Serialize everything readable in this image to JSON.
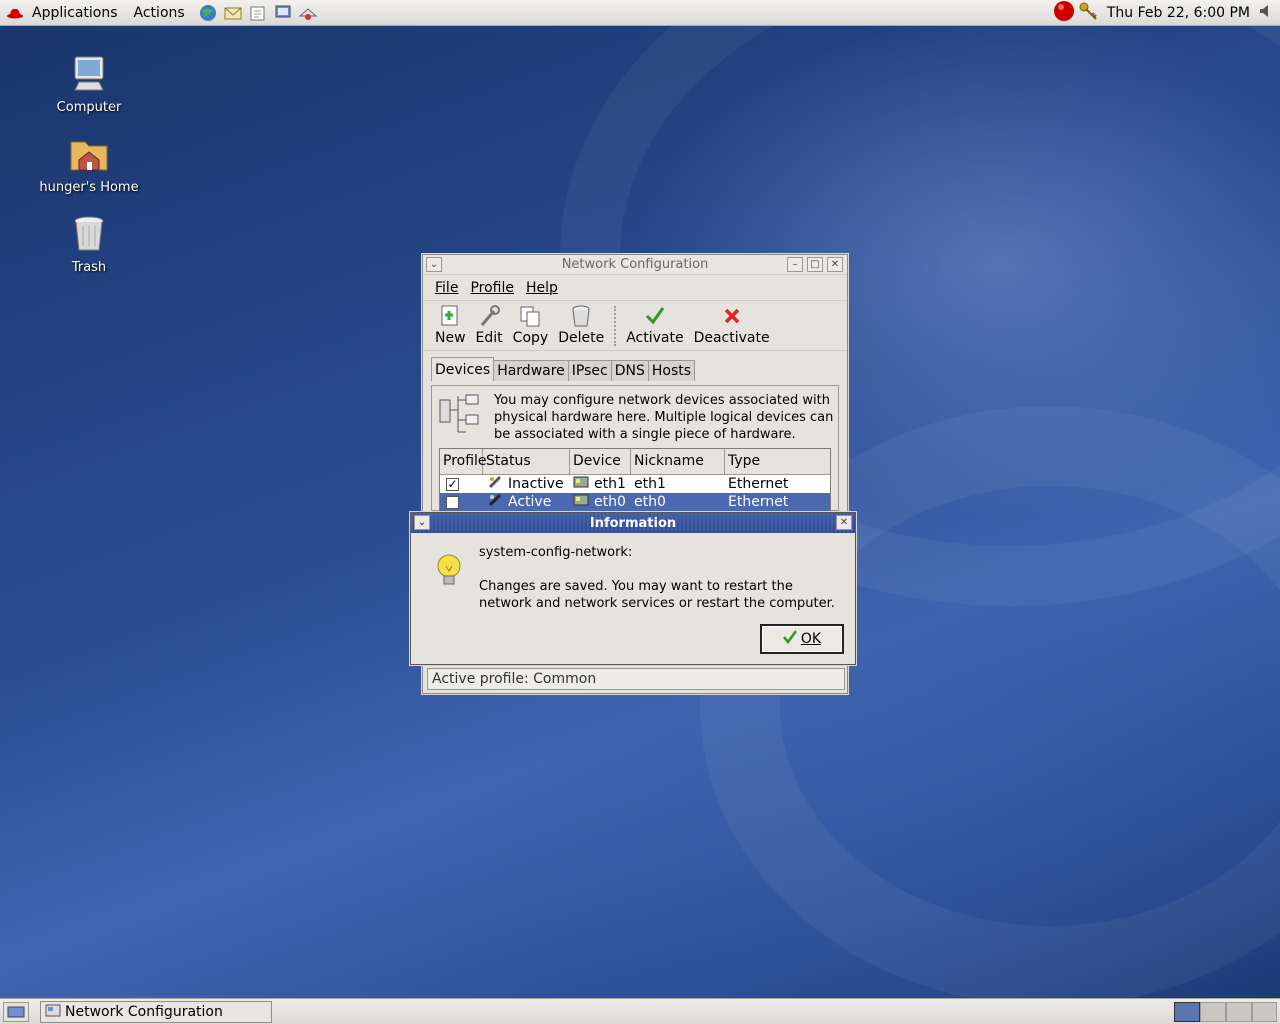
{
  "top_panel": {
    "applications_label": "Applications",
    "actions_label": "Actions",
    "clock": "Thu Feb 22,  6:00 PM"
  },
  "desktop_icons": [
    {
      "label": "Computer"
    },
    {
      "label": "hunger's Home"
    },
    {
      "label": "Trash"
    }
  ],
  "network_window": {
    "title": "Network Configuration",
    "menu": [
      "File",
      "Profile",
      "Help"
    ],
    "toolbar": {
      "new": "New",
      "edit": "Edit",
      "copy": "Copy",
      "delete": "Delete",
      "activate": "Activate",
      "deactivate": "Deactivate"
    },
    "tabs": [
      "Devices",
      "Hardware",
      "IPsec",
      "DNS",
      "Hosts"
    ],
    "description": "You may configure network devices associated with physical hardware here.  Multiple logical devices can be associated with a single piece of hardware.",
    "columns": [
      "Profile",
      "Status",
      "Device",
      "Nickname",
      "Type"
    ],
    "rows": [
      {
        "profile_checked": true,
        "status": "Inactive",
        "device": "eth1",
        "nickname": "eth1",
        "type": "Ethernet"
      },
      {
        "profile_checked": false,
        "status": "Active",
        "device": "eth0",
        "nickname": "eth0",
        "type": "Ethernet"
      }
    ],
    "statusbar": "Active profile: Common"
  },
  "info_dialog": {
    "title": "Information",
    "heading": "system-config-network:",
    "message": "Changes are saved. You may want to restart the network and network services or restart the computer.",
    "ok_label": "OK"
  },
  "bottom_panel": {
    "task_label": "Network Configuration"
  },
  "colors": {
    "desktop": "#2a4d92",
    "selection": "#4b69b0",
    "active_title": "#2f4a92"
  }
}
